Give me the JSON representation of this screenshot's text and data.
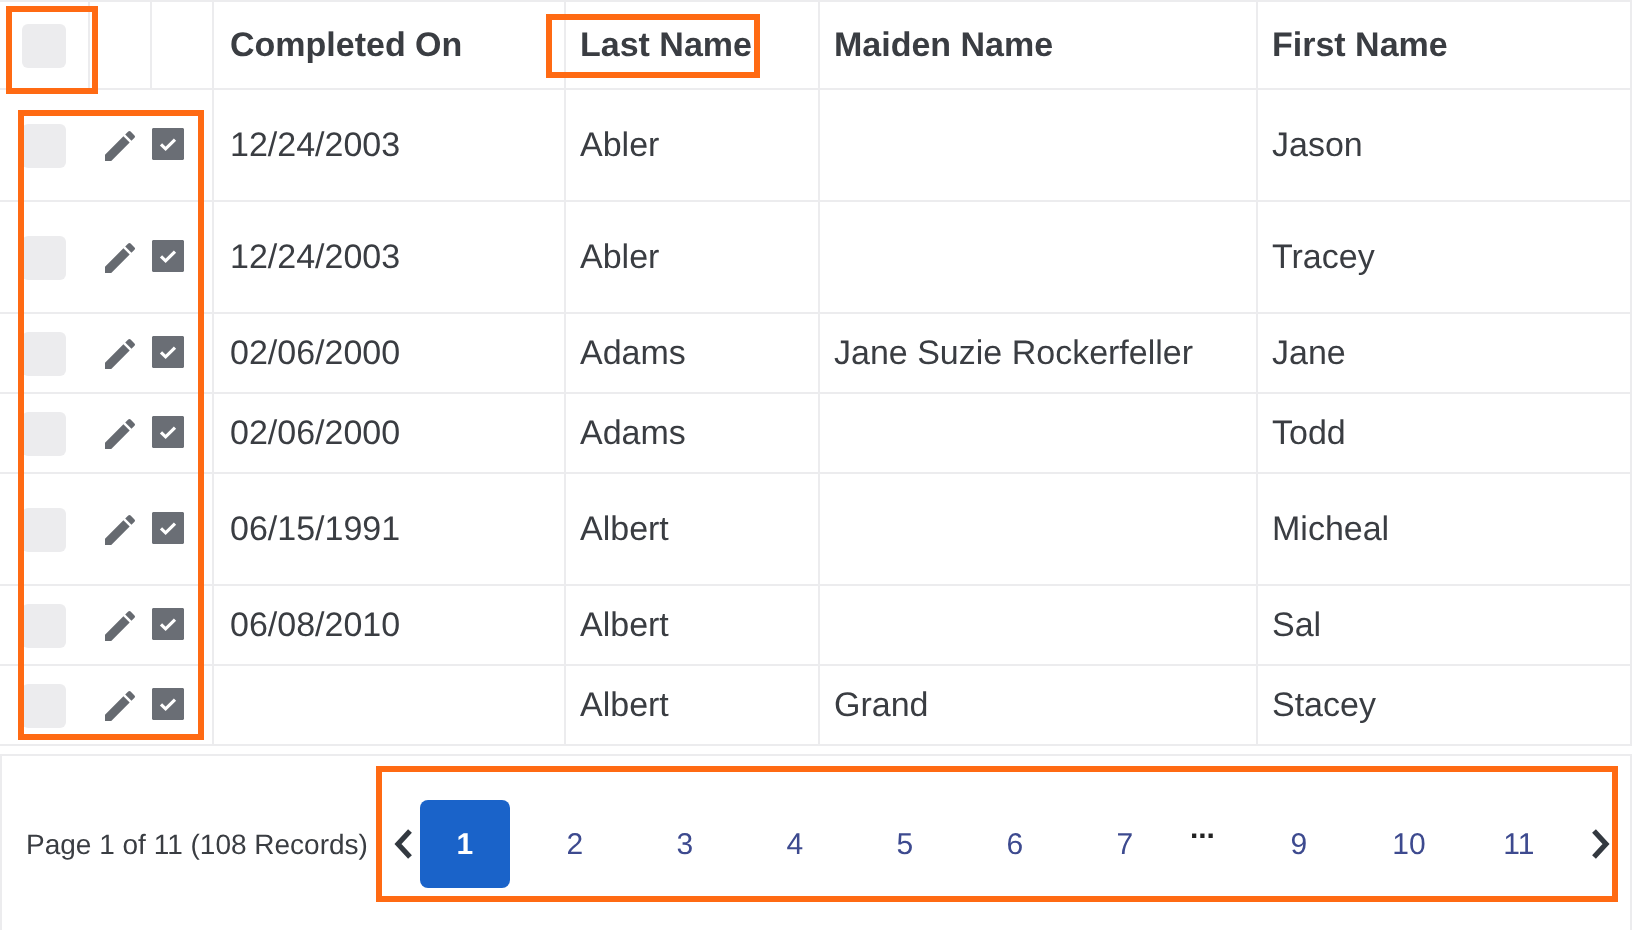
{
  "table": {
    "header_checkbox": {
      "checked": false
    },
    "columns": [
      "Completed On",
      "Last Name",
      "Maiden Name",
      "First Name"
    ],
    "rows": [
      {
        "selected": false,
        "checked": true,
        "cells": [
          "12/24/2003",
          "Abler",
          "",
          "Jason"
        ]
      },
      {
        "selected": false,
        "checked": true,
        "cells": [
          "12/24/2003",
          "Abler",
          "",
          "Tracey"
        ]
      },
      {
        "selected": false,
        "checked": true,
        "cells": [
          "02/06/2000",
          "Adams",
          "Jane Suzie Rockerfeller",
          "Jane"
        ]
      },
      {
        "selected": false,
        "checked": true,
        "cells": [
          "02/06/2000",
          "Adams",
          "",
          "Todd"
        ]
      },
      {
        "selected": false,
        "checked": true,
        "cells": [
          "06/15/1991",
          "Albert",
          "",
          "Micheal"
        ]
      },
      {
        "selected": false,
        "checked": true,
        "cells": [
          "06/08/2010",
          "Albert",
          "",
          "Sal"
        ]
      },
      {
        "selected": false,
        "checked": true,
        "cells": [
          "",
          "Albert",
          "Grand",
          "Stacey"
        ]
      }
    ]
  },
  "pagination": {
    "summary": "Page 1 of 11 (108 Records)",
    "pages": [
      {
        "label": "1",
        "selected": true
      },
      {
        "label": "2",
        "selected": false
      },
      {
        "label": "3",
        "selected": false
      },
      {
        "label": "4",
        "selected": false
      },
      {
        "label": "5",
        "selected": false
      },
      {
        "label": "6",
        "selected": false
      },
      {
        "label": "7",
        "selected": false
      },
      {
        "label": "...",
        "kind": "ellipsis"
      },
      {
        "label": "9",
        "selected": false
      },
      {
        "label": "10",
        "selected": false
      },
      {
        "label": "11",
        "selected": false
      }
    ]
  }
}
